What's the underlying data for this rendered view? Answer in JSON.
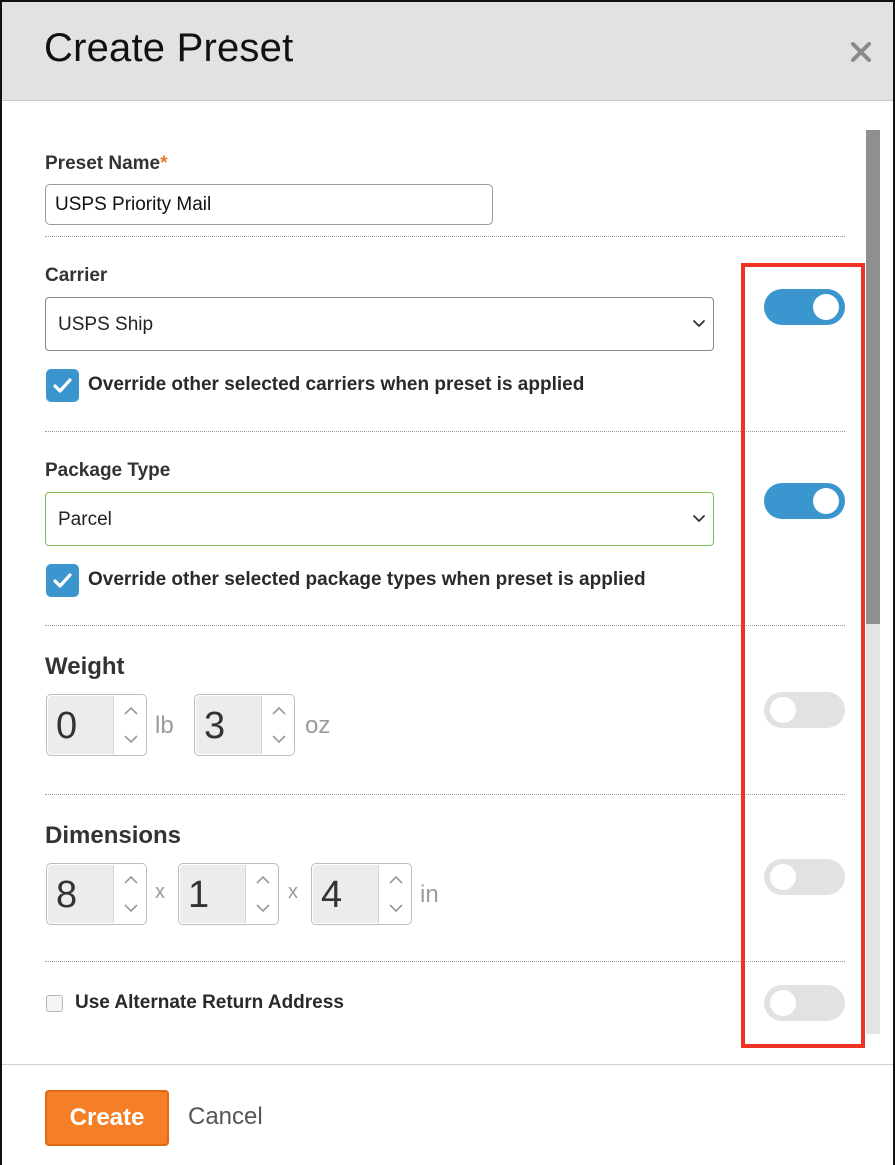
{
  "dialog": {
    "title": "Create Preset",
    "close_icon": "close-icon"
  },
  "preset_name": {
    "label": "Preset Name",
    "required_marker": "*",
    "value": "USPS Priority Mail"
  },
  "carrier": {
    "label": "Carrier",
    "selected": "USPS Ship",
    "override_checked": true,
    "override_label": "Override other selected carriers when preset is applied",
    "toggle_on": true
  },
  "package_type": {
    "label": "Package Type",
    "selected": "Parcel",
    "override_checked": true,
    "override_label": "Override other selected package types when preset is applied",
    "toggle_on": true
  },
  "weight": {
    "label": "Weight",
    "lb_value": "0",
    "lb_unit": "lb",
    "oz_value": "3",
    "oz_unit": "oz",
    "toggle_on": false
  },
  "dimensions": {
    "label": "Dimensions",
    "length": "8",
    "width": "1",
    "height": "4",
    "separator": "x",
    "unit": "in",
    "toggle_on": false
  },
  "alternate_return": {
    "label": "Use Alternate Return Address",
    "checked": false,
    "toggle_on": false
  },
  "footer": {
    "create_label": "Create",
    "cancel_label": "Cancel"
  },
  "colors": {
    "accent_blue": "#3b95cf",
    "create_orange": "#f47f26",
    "highlight_red": "#ef3324",
    "required_orange": "#e8782a"
  }
}
